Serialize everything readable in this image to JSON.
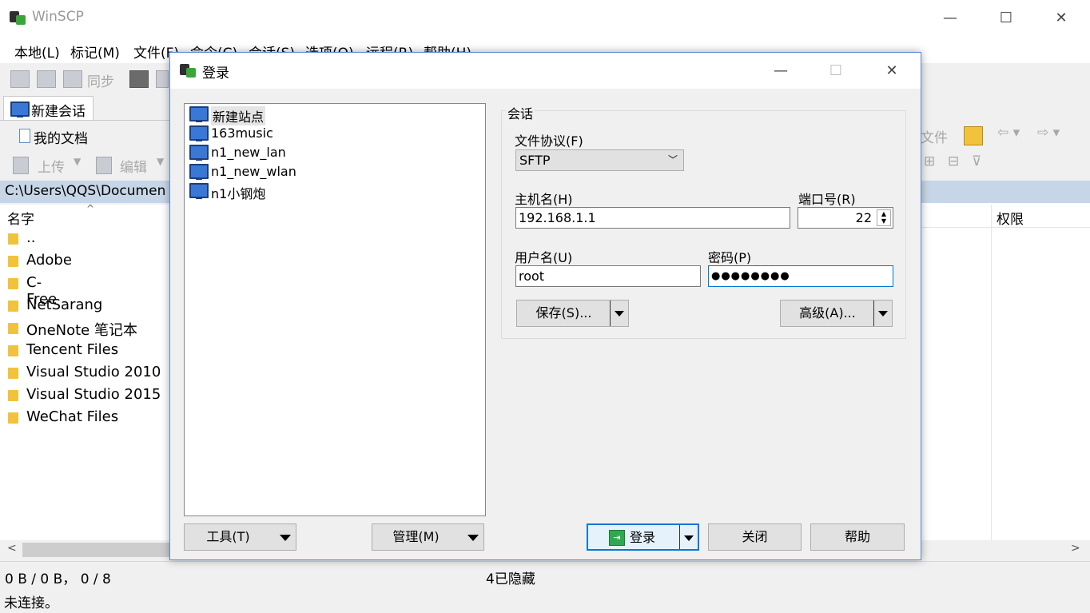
{
  "app": {
    "title": "WinSCP"
  },
  "menu": [
    "本地(L)",
    "标记(M)",
    "文件(F)",
    "命令(C)",
    "会话(S)",
    "选项(O)",
    "远程(R)",
    "帮助(H)"
  ],
  "toolbar": {
    "sync_label": "同步",
    "new_session_tab": "新建会话",
    "my_docs": "我的文档",
    "upload_label": "上传",
    "edit_label": "编辑",
    "remote_file_label": "文件"
  },
  "local": {
    "path": "C:\\Users\\QQS\\Documen",
    "col_name": "名字",
    "files": [
      "..",
      "Adobe",
      "C-Free",
      "NetSarang",
      "OneNote 笔记本",
      "Tencent Files",
      "Visual Studio 2010",
      "Visual Studio 2015",
      "WeChat Files"
    ]
  },
  "remote": {
    "col_perm": "权限"
  },
  "status": {
    "transfer": "0 B / 0 B， 0 / 8",
    "hidden": "4已隐藏",
    "connection": "未连接。"
  },
  "dialog": {
    "title": "登录",
    "sites": [
      "新建站点",
      "163music",
      "n1_new_lan",
      "n1_new_wlan",
      "n1小钢炮"
    ],
    "group_title": "会话",
    "protocol_label": "文件协议(F)",
    "protocol_value": "SFTP",
    "host_label": "主机名(H)",
    "host_value": "192.168.1.1",
    "port_label": "端口号(R)",
    "port_value": "22",
    "user_label": "用户名(U)",
    "user_value": "root",
    "pass_label": "密码(P)",
    "pass_value": "●●●●●●●●",
    "save_button": "保存(S)...",
    "advanced_button": "高级(A)...",
    "tools_button": "工具(T)",
    "manage_button": "管理(M)",
    "login_button": "登录",
    "close_button": "关闭",
    "help_button": "帮助"
  }
}
